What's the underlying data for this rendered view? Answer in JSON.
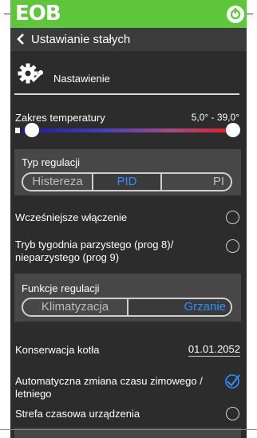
{
  "app": {
    "logo_text": "EOB",
    "colors": {
      "topbar": "#5ec63a",
      "accent": "#2f8fff",
      "background": "#2c2c2c",
      "panel": "#474747"
    },
    "icons": {
      "power": "power-icon",
      "back": "chevron-left-icon",
      "settings": "gear-wrench-icon",
      "check": "checkmark-icon"
    }
  },
  "header": {
    "title": "Ustawianie stałych"
  },
  "section": {
    "title": "Nastawienie"
  },
  "temperature": {
    "label": "Zakres temperatury",
    "value": "5,0° -  39,0°",
    "min": 5.0,
    "max": 39.0
  },
  "regulation_type": {
    "label": "Typ regulacji",
    "options": [
      "Histereza",
      "PID",
      "PI"
    ],
    "selected": "PID"
  },
  "early_start": {
    "label": "Wcześniejsze włączenie",
    "checked": false
  },
  "week_mode": {
    "label": "Tryb tygodnia parzystego (prog 8)/ nieparzystego (prog 9)",
    "checked": false
  },
  "regulation_function": {
    "label": "Funkcje regulacji",
    "options": [
      "Klimatyzacja",
      "Grzanie"
    ],
    "selected": "Grzanie"
  },
  "boiler_maintenance": {
    "label": "Konserwacja kotła",
    "date": "01.01.2052"
  },
  "auto_dst": {
    "label": "Automatyczna zmiana czasu zimowego / letniego",
    "checked": true
  },
  "timezone": {
    "label": "Strefa czasowa urządzenia",
    "checked": false
  }
}
